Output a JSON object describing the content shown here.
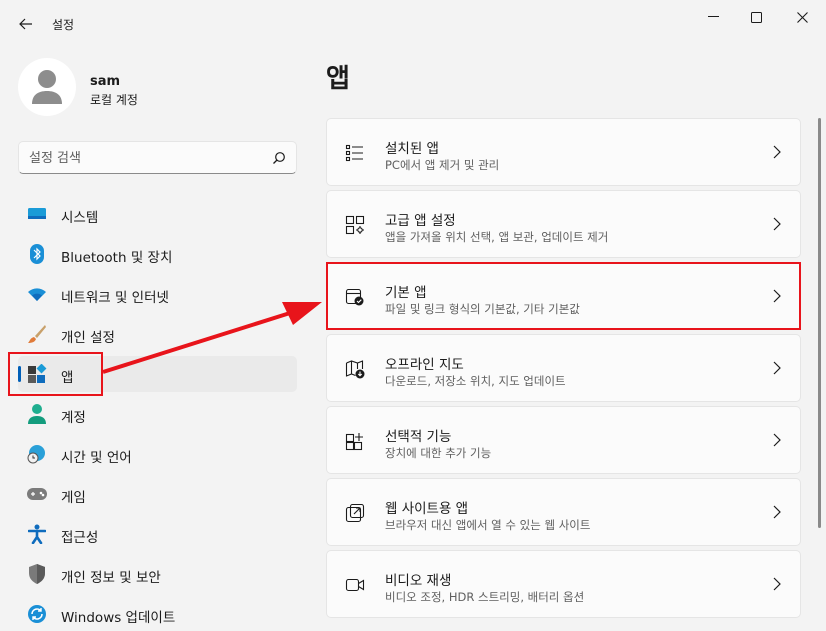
{
  "window": {
    "title": "설정"
  },
  "profile": {
    "name": "sam",
    "subtitle": "로컬 계정"
  },
  "search": {
    "placeholder": "설정 검색"
  },
  "sidebar": {
    "items": [
      {
        "label": "시스템",
        "icon": "system-icon"
      },
      {
        "label": "Bluetooth 및 장치",
        "icon": "bluetooth-icon"
      },
      {
        "label": "네트워크 및 인터넷",
        "icon": "wifi-icon"
      },
      {
        "label": "개인 설정",
        "icon": "brush-icon"
      },
      {
        "label": "앱",
        "icon": "apps-icon",
        "active": true
      },
      {
        "label": "계정",
        "icon": "account-icon"
      },
      {
        "label": "시간 및 언어",
        "icon": "globe-clock-icon"
      },
      {
        "label": "게임",
        "icon": "gamepad-icon"
      },
      {
        "label": "접근성",
        "icon": "accessibility-icon"
      },
      {
        "label": "개인 정보 및 보안",
        "icon": "shield-icon"
      },
      {
        "label": "Windows 업데이트",
        "icon": "update-icon"
      }
    ]
  },
  "main": {
    "title": "앱",
    "cards": [
      {
        "title": "설치된 앱",
        "subtitle": "PC에서 앱 제거 및 관리",
        "icon": "list-icon"
      },
      {
        "title": "고급 앱 설정",
        "subtitle": "앱을 가져올 위치 선택, 앱 보관, 업데이트 제거",
        "icon": "app-settings-icon"
      },
      {
        "title": "기본 앱",
        "subtitle": "파일 및 링크 형식의 기본값, 기타 기본값",
        "icon": "default-apps-icon"
      },
      {
        "title": "오프라인 지도",
        "subtitle": "다운로드, 저장소 위치, 지도 업데이트",
        "icon": "map-icon"
      },
      {
        "title": "선택적 기능",
        "subtitle": "장치에 대한 추가 기능",
        "icon": "optional-features-icon"
      },
      {
        "title": "웹 사이트용 앱",
        "subtitle": "브라우저 대신 앱에서 열 수 있는 웹 사이트",
        "icon": "open-in-app-icon"
      },
      {
        "title": "비디오 재생",
        "subtitle": "비디오 조정, HDR 스트리밍, 배터리 옵션",
        "icon": "video-icon"
      }
    ]
  },
  "colors": {
    "accent": "#005fb8",
    "annotation": "#e8141b",
    "background": "#f3f3f3",
    "card": "#fbfbfb"
  }
}
